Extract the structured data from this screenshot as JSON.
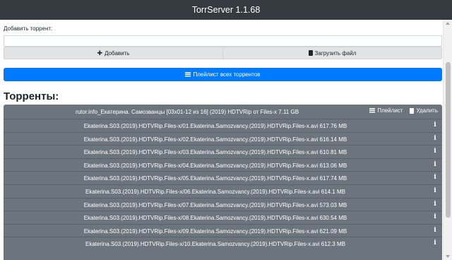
{
  "app": {
    "title": "TorrServer 1.1.68"
  },
  "add_form": {
    "label": "Добавить торрент:",
    "input_value": "",
    "add_button": "Добавить",
    "upload_button": "Загрузить файл"
  },
  "playlist_all_button": "Плейлист всех торрентов",
  "section_title": "Торренты:",
  "torrent": {
    "name": "rutor.info_Екатерина. Самозванцы [03x01-12 из 16] (2019) HDTVRip от Files-x 7.11 GB",
    "playlist_label": "Плейлист",
    "delete_label": "Удалить",
    "files": [
      "Ekaterina.S03.(2019).HDTVRip.Files-x/01.Ekaterina.Samozvancy.(2019).HDTVRip.Files-x.avi 617.76 MB",
      "Ekaterina.S03.(2019).HDTVRip.Files-x/02.Ekaterina.Samozvancy.(2019).HDTVRip.Files-x.avi 616.14 MB",
      "Ekaterina.S03.(2019).HDTVRip.Files-x/03.Ekaterina.Samozvancy.(2019).HDTVRip.Files-x.avi 610.81 MB",
      "Ekaterina.S03.(2019).HDTVRip.Files-x/04.Ekaterina.Samozvancy.(2019).HDTVRip.Files-x.avi 613.06 MB",
      "Ekaterina.S03.(2019).HDTVRip.Files-x/05.Ekaterina.Samozvancy.(2019).HDTVRip.Files-x.avi 617.74 MB",
      "Ekaterina.S03.(2019).HDTVRip.Files-x/06.Ekaterina.Samozvancy.(2019).HDTVRip.Files-x.avi 614.1 MB",
      "Ekaterina.S03.(2019).HDTVRip.Files-x/07.Ekaterina.Samozvancy.(2019).HDTVRip.Files-x.avi 573.03 MB",
      "Ekaterina.S03.(2019).HDTVRip.Files-x/08.Ekaterina.Samozvancy.(2019).HDTVRip.Files-x.avi 630.54 MB",
      "Ekaterina.S03.(2019).HDTVRip.Files-x/09.Ekaterina.Samozvancy.(2019).HDTVRip.Files-x.avi 621.09 MB",
      "Ekaterina.S03.(2019).HDTVRip.Files-x/10.Ekaterina.Samozvancy.(2019).HDTVRip.Files-x.avi 612.3 MB"
    ],
    "info_icon": "i"
  },
  "icons": {
    "add": "plus-icon",
    "upload": "file-upload-icon",
    "playlist": "list-icon",
    "delete": "trash-icon",
    "info": "info-icon"
  },
  "colors": {
    "navbar": "#343a40",
    "primary": "#007bff",
    "card": "#6c757d",
    "button_light": "#e2e3e5"
  }
}
